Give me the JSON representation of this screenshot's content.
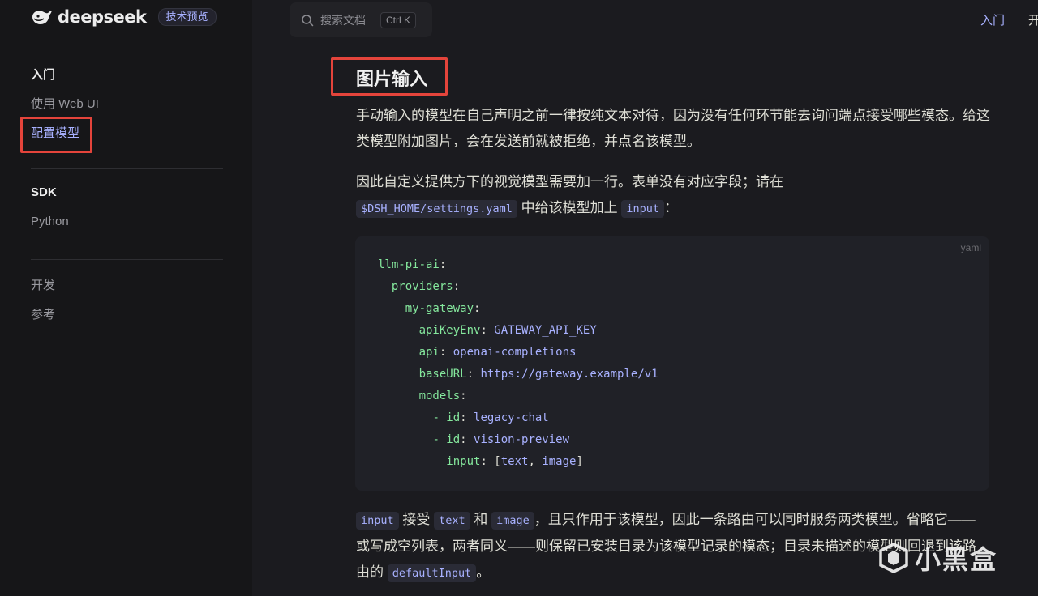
{
  "sidebar": {
    "logo_text": "deepseek",
    "badge": "技术预览",
    "section1_title": "入门",
    "section1_items": [
      "使用 Web UI",
      "配置模型"
    ],
    "section2_title": "SDK",
    "section2_items": [
      "Python"
    ],
    "section3_items": [
      "开发",
      "参考"
    ]
  },
  "topbar": {
    "search_placeholder": "搜索文档",
    "search_shortcut": "Ctrl K",
    "links": [
      "入门",
      "开"
    ]
  },
  "content": {
    "heading": "图片输入",
    "para1": "手动输入的模型在自己声明之前一律按纯文本对待，因为没有任何环节能去询问端点接受哪些模态。给这类模型附加图片，会在发送前就被拒绝，并点名该模型。",
    "para2_text1": "因此自定义提供方下的视觉模型需要加一行。表单没有对应字段；请在",
    "para2_code1": "$DSH_HOME/settings.yaml",
    "para2_text2": " 中给该模型加上 ",
    "para2_code2": "input",
    "para2_text3": "：",
    "code_lang": "yaml",
    "code": {
      "l1_key": "llm-pi-ai",
      "l2_key": "providers",
      "l3_key": "my-gateway",
      "l4_key": "apiKeyEnv",
      "l4_val": "GATEWAY_API_KEY",
      "l5_key": "api",
      "l5_val": "openai-completions",
      "l6_key": "baseURL",
      "l6_val": "https://gateway.example/v1",
      "l7_key": "models",
      "l8_key": "id",
      "l8_val": "legacy-chat",
      "l9_key": "id",
      "l9_val": "vision-preview",
      "l10_key": "input",
      "l10_val1": "text",
      "l10_val2": "image"
    },
    "para3_code1": "input",
    "para3_text1": " 接受 ",
    "para3_code2": "text",
    "para3_text2": " 和 ",
    "para3_code3": "image",
    "para3_text3": "，且只作用于该模型，因此一条路由可以同时服务两类模型。省略它——或写成空列表，两者同义——则保留已安装目录为该模型记录的模态；目录未描述的模型则回退到该路由的 ",
    "para3_code4": "defaultInput",
    "para3_text4": "。"
  },
  "watermark": "小黑盒",
  "colors": {
    "accent": "#a8b1ff",
    "highlight_box": "#e4443b",
    "code_key": "#85e89d",
    "background": "#1b1b1f"
  },
  "icons": [
    "whale-logo-icon",
    "search-icon",
    "watermark-logo-icon"
  ]
}
